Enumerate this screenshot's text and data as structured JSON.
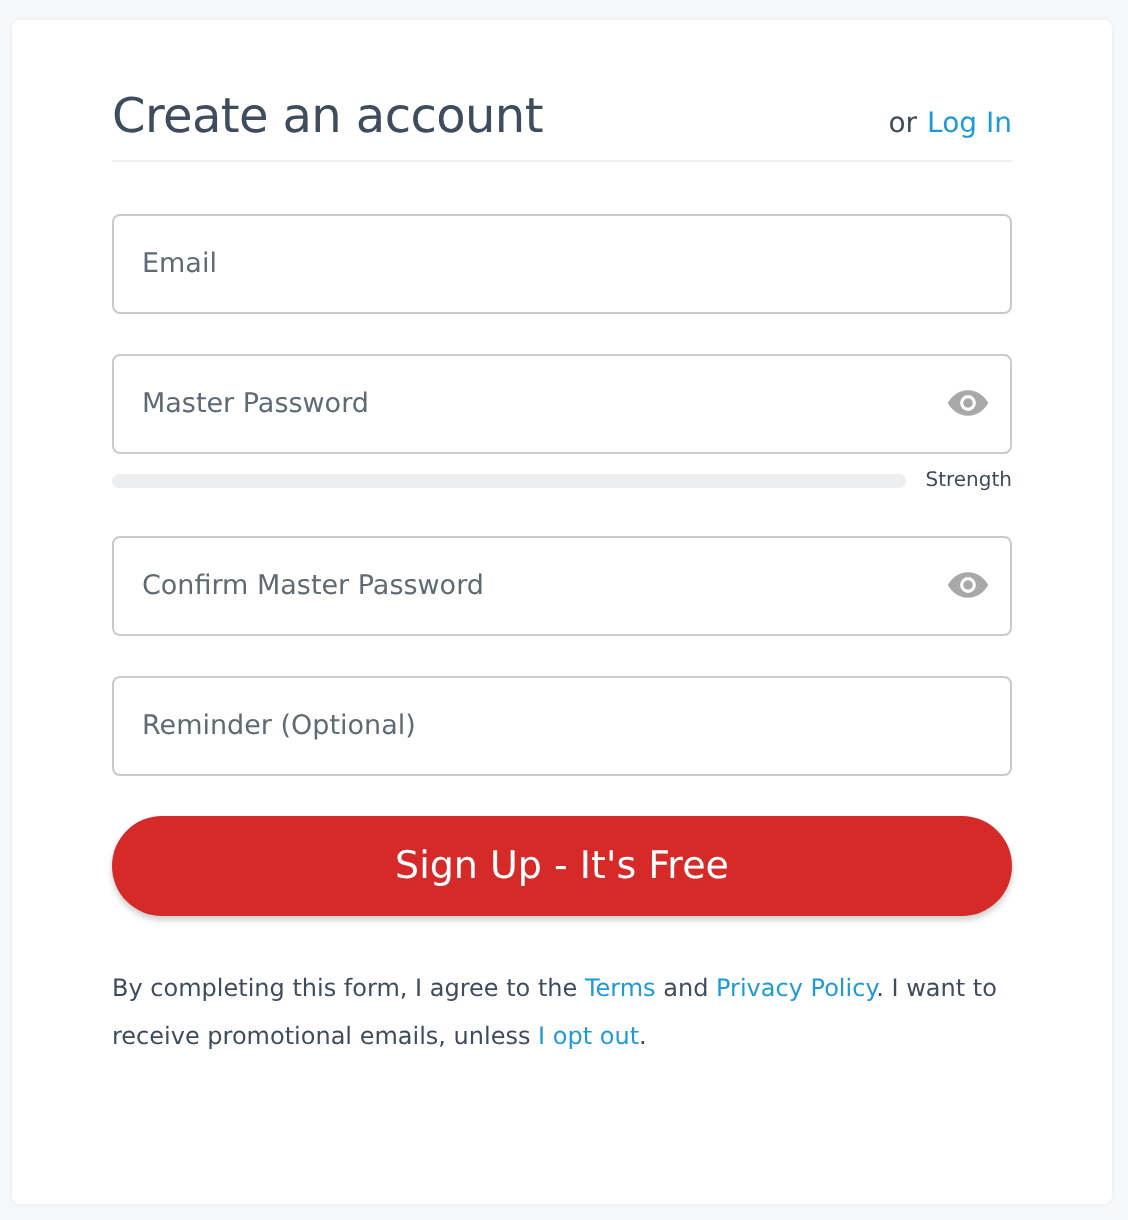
{
  "title": "Create an account",
  "login": {
    "prefix": "or",
    "link": "Log In"
  },
  "fields": [
    {
      "placeholder": "Email",
      "reveal": false
    },
    {
      "placeholder": "Master Password",
      "reveal": true,
      "strength": {
        "level": 0,
        "label": "Strength"
      }
    },
    {
      "placeholder": "Confirm Master Password",
      "reveal": true
    },
    {
      "placeholder": "Reminder (Optional)",
      "reveal": false
    }
  ],
  "submit": "Sign Up - It's Free",
  "legal": [
    {
      "kind": "text",
      "text": "By completing this form, I agree to the "
    },
    {
      "kind": "link",
      "text": "Terms"
    },
    {
      "kind": "text",
      "text": " and "
    },
    {
      "kind": "link",
      "text": "Privacy Policy"
    },
    {
      "kind": "text",
      "text": ". I want to receive promotional emails, unless "
    },
    {
      "kind": "link",
      "text": "I opt out"
    },
    {
      "kind": "text",
      "text": "."
    }
  ]
}
